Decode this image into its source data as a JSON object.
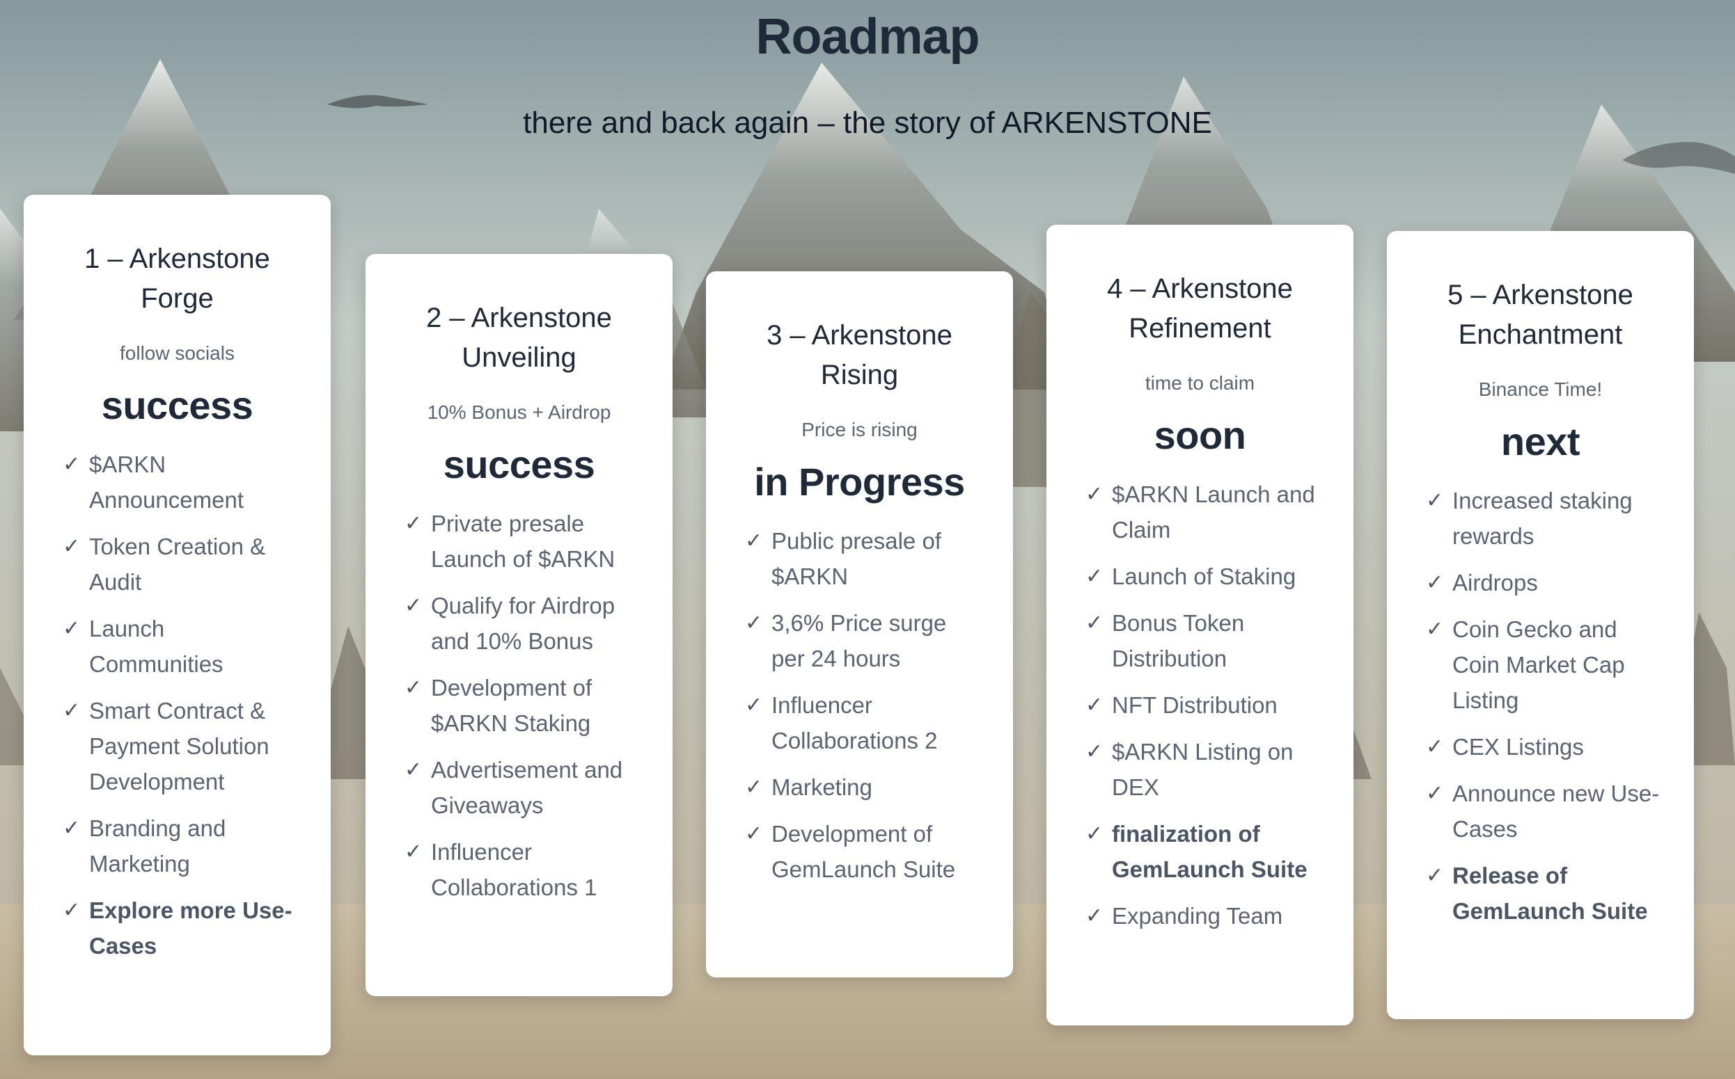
{
  "page": {
    "title": "Roadmap",
    "subtitle": "there and back again – the story of ARKENSTONE"
  },
  "cards": [
    {
      "title": "1 – Arkenstone Forge",
      "subtitle": "follow socials",
      "status": "success",
      "items": [
        {
          "text": "$ARKN Announcement",
          "bold": false
        },
        {
          "text": "Token Creation & Audit",
          "bold": false
        },
        {
          "text": "Launch Communities",
          "bold": false
        },
        {
          "text": "Smart Contract & Payment Solution Development",
          "bold": false
        },
        {
          "text": "Branding and Marketing",
          "bold": false
        },
        {
          "text": "Explore more Use-Cases",
          "bold": true
        }
      ]
    },
    {
      "title": "2 – Arkenstone Unveiling",
      "subtitle": "10% Bonus + Airdrop",
      "status": "success",
      "items": [
        {
          "text": "Private presale Launch of $ARKN",
          "bold": false
        },
        {
          "text": "Qualify for Airdrop and 10% Bonus",
          "bold": false
        },
        {
          "text": "Development of $ARKN Staking",
          "bold": false
        },
        {
          "text": "Advertisement and Giveaways",
          "bold": false
        },
        {
          "text": "Influencer Collaborations 1",
          "bold": false
        }
      ]
    },
    {
      "title": "3 – Arkenstone Rising",
      "subtitle": "Price is rising",
      "status": "in Progress",
      "items": [
        {
          "text": "Public presale of $ARKN",
          "bold": false
        },
        {
          "text": "3,6% Price surge per 24 hours",
          "bold": false
        },
        {
          "text": "Influencer Collaborations 2",
          "bold": false
        },
        {
          "text": "Marketing",
          "bold": false
        },
        {
          "text": "Development of GemLaunch Suite",
          "bold": false
        }
      ]
    },
    {
      "title": "4 – Arkenstone Refinement",
      "subtitle": "time to claim",
      "status": "soon",
      "items": [
        {
          "text": "$ARKN Launch and Claim",
          "bold": false
        },
        {
          "text": "Launch of Staking",
          "bold": false
        },
        {
          "text": "Bonus Token Distribution",
          "bold": false
        },
        {
          "text": "NFT Distribution",
          "bold": false
        },
        {
          "text": "$ARKN Listing on DEX",
          "bold": false
        },
        {
          "text": "finalization of GemLaunch Suite",
          "bold": true
        },
        {
          "text": "Expanding Team",
          "bold": false
        }
      ]
    },
    {
      "title": "5 – Arkenstone Enchantment",
      "subtitle": "Binance Time!",
      "status": "next",
      "items": [
        {
          "text": "Increased staking rewards",
          "bold": false
        },
        {
          "text": "Airdrops",
          "bold": false
        },
        {
          "text": "Coin Gecko and Coin Market Cap Listing",
          "bold": false
        },
        {
          "text": "CEX Listings",
          "bold": false
        },
        {
          "text": "Announce new Use-Cases",
          "bold": false
        },
        {
          "text": "Release of GemLaunch Suite",
          "bold": true
        }
      ]
    }
  ],
  "icons": {
    "check": "✓"
  },
  "colors": {
    "heading": "#1e2a38",
    "card_background": "#ffffff",
    "item_text": "#5b6472"
  }
}
